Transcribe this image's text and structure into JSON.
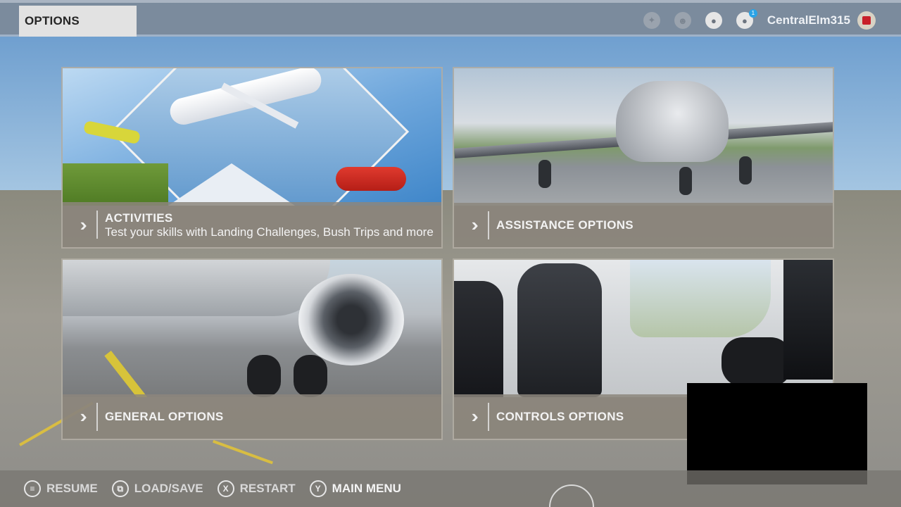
{
  "header": {
    "title": "OPTIONS",
    "username": "CentralElm315",
    "notification_count": "1",
    "icons": [
      "achievement-icon",
      "friends-icon",
      "profile-icon",
      "notifications-icon"
    ]
  },
  "cards": [
    {
      "label": "ACTIVITIES",
      "description": "Test your skills with Landing Challenges, Bush Trips and more"
    },
    {
      "label": "ASSISTANCE OPTIONS"
    },
    {
      "label": "GENERAL OPTIONS"
    },
    {
      "label": "CONTROLS OPTIONS"
    }
  ],
  "footer": {
    "actions": [
      {
        "button": "≡",
        "label": "RESUME"
      },
      {
        "button": "⧉",
        "label": "LOAD/SAVE"
      },
      {
        "button": "X",
        "label": "RESTART"
      },
      {
        "button": "Y",
        "label": "MAIN MENU"
      }
    ]
  },
  "colors": {
    "topbar": "#78849 4",
    "title_tab_bg": "#e2e2e2",
    "badge": "#2aa3e6",
    "taxi_line": "#d7c33a"
  }
}
